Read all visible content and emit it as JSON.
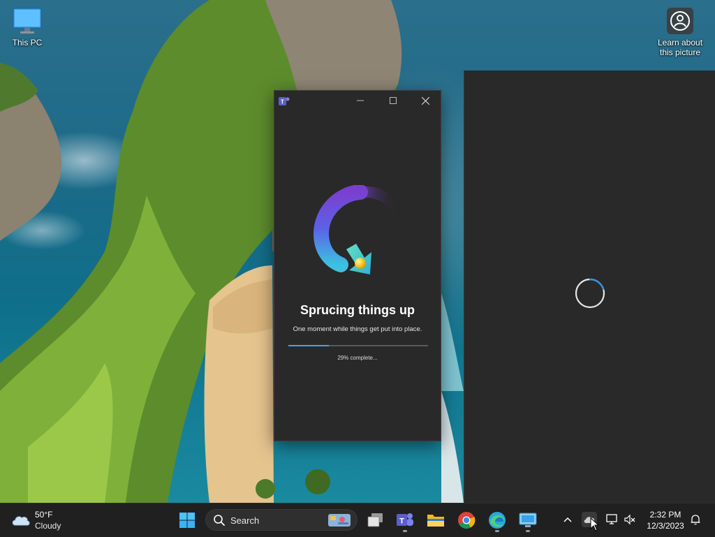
{
  "desktop": {
    "icons": [
      {
        "label": "This PC",
        "icon": "monitor-icon"
      },
      {
        "label": "Learn about this picture",
        "icon": "camera-circle-icon"
      }
    ]
  },
  "teams_splash": {
    "app_icon": "teams-icon",
    "title": "Sprucing things up",
    "subtitle": "One moment while things get put into place.",
    "progress_percent": 29,
    "progress_label": "29% complete..."
  },
  "loading_window": {
    "spinner": "loading-spinner-icon"
  },
  "taskbar": {
    "weather": {
      "temp": "50°F",
      "condition": "Cloudy"
    },
    "search_placeholder": "Search",
    "apps": [
      "start-icon",
      "task-view-icon",
      "teams-icon",
      "file-explorer-icon",
      "chrome-icon",
      "edge-icon",
      "rdp-icon"
    ],
    "clock": {
      "time": "2:32 PM",
      "date": "12/3/2023"
    }
  },
  "colors": {
    "window_bg": "#292929",
    "taskbar_bg": "#202020",
    "progress_fill": "#4f9fe6",
    "progress_track": "#5a5a5a"
  }
}
